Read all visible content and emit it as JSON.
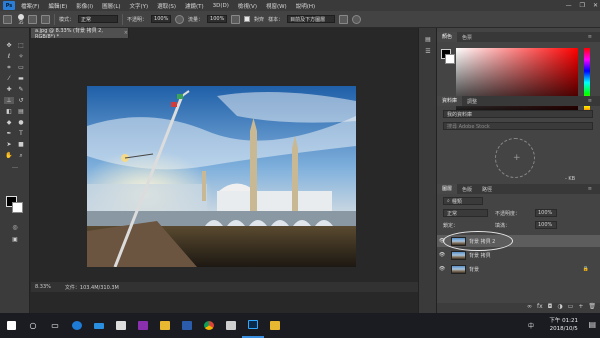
{
  "menubar": {
    "app_logo": "Ps",
    "items": [
      "檔案(F)",
      "編輯(E)",
      "影像(I)",
      "圖層(L)",
      "文字(Y)",
      "選取(S)",
      "濾鏡(T)",
      "3D(D)",
      "檢視(V)",
      "視窗(W)",
      "說明(H)"
    ],
    "window_controls": [
      "—",
      "❐",
      "✕"
    ]
  },
  "optionsbar": {
    "brush_size": "35",
    "mode_label": "模式：",
    "mode_value": "正常",
    "opacity_label": "不透明：",
    "opacity_value": "100%",
    "flow_label": "流量：",
    "flow_value": "100%",
    "aligned_label": "對齊",
    "sample_label": "樣本：",
    "sample_value": "目前及下方圖層"
  },
  "document": {
    "tab_title": "a.jpg @ 8.33% (背景 拷貝 2, RGB/8*) *",
    "close": "×",
    "status_zoom": "8.33%",
    "status_doc": "文件：103.4M/310.3M"
  },
  "panels": {
    "color_tabs": [
      "顏色",
      "色票"
    ],
    "library_tabs": [
      "資料庫",
      "調整"
    ],
    "library_select": "我的資料庫",
    "library_search": "搜尋 Adobe Stock",
    "library_size": "- KB",
    "layers_tabs": [
      "圖層",
      "色版",
      "路徑"
    ],
    "filter_label": "種類",
    "blend_mode": "正常",
    "opacity_label": "不透明度：",
    "opacity_value": "100%",
    "lock_label": "鎖定：",
    "fill_label": "填滿：",
    "fill_value": "100%",
    "layers": [
      {
        "name": "背景 拷貝 2",
        "selected": true,
        "locked": false
      },
      {
        "name": "背景 拷貝",
        "selected": false,
        "locked": false
      },
      {
        "name": "背景",
        "selected": false,
        "locked": true
      }
    ]
  },
  "taskbar": {
    "time": "下午 01:21",
    "date": "2018/10/5",
    "language": "中",
    "apps": [
      "windows-logo",
      "search",
      "task-view",
      "edge",
      "onedrive",
      "store",
      "onenote",
      "explorer",
      "word",
      "chrome",
      "remote",
      "photoshop",
      "folder"
    ]
  }
}
